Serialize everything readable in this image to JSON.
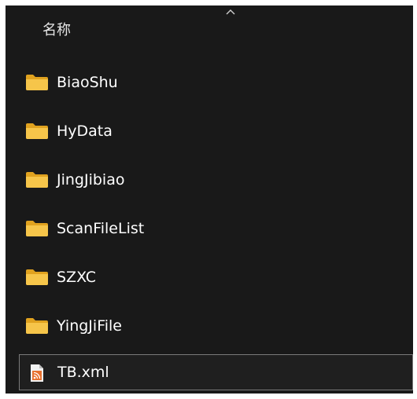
{
  "header": {
    "name_column": "名称",
    "sort_icon": "chevron-up-icon"
  },
  "items": [
    {
      "name": "BiaoShu",
      "type": "folder",
      "icon": "folder-icon"
    },
    {
      "name": "HyData",
      "type": "folder",
      "icon": "folder-icon"
    },
    {
      "name": "JingJibiao",
      "type": "folder",
      "icon": "folder-icon"
    },
    {
      "name": "ScanFileList",
      "type": "folder",
      "icon": "folder-icon"
    },
    {
      "name": "SZXC",
      "type": "folder",
      "icon": "folder-icon"
    },
    {
      "name": "YingJiFile",
      "type": "folder",
      "icon": "folder-icon"
    },
    {
      "name": "TB.xml",
      "type": "file",
      "icon": "rss-file-icon",
      "selected": true
    }
  ],
  "colors": {
    "background": "#191919",
    "text": "#ffffff",
    "folder": "#f0b429",
    "rss": "#e8712e"
  }
}
